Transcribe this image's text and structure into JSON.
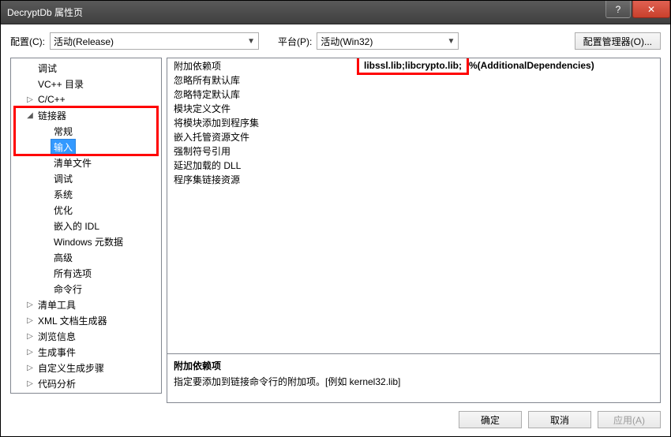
{
  "window": {
    "title": "DecryptDb 属性页"
  },
  "toolbar": {
    "config_label": "配置(C):",
    "config_value": "活动(Release)",
    "platform_label": "平台(P):",
    "platform_value": "活动(Win32)",
    "config_mgr": "配置管理器(O)..."
  },
  "tree": [
    {
      "label": "调试",
      "level": 1,
      "expand": ""
    },
    {
      "label": "VC++ 目录",
      "level": 1,
      "expand": ""
    },
    {
      "label": "C/C++",
      "level": 1,
      "expand": "▷"
    },
    {
      "label": "链接器",
      "level": 1,
      "expand": "◢"
    },
    {
      "label": "常规",
      "level": 2,
      "expand": ""
    },
    {
      "label": "输入",
      "level": 2,
      "expand": "",
      "selected": true
    },
    {
      "label": "清单文件",
      "level": 2,
      "expand": ""
    },
    {
      "label": "调试",
      "level": 2,
      "expand": ""
    },
    {
      "label": "系统",
      "level": 2,
      "expand": ""
    },
    {
      "label": "优化",
      "level": 2,
      "expand": ""
    },
    {
      "label": "嵌入的 IDL",
      "level": 2,
      "expand": ""
    },
    {
      "label": "Windows 元数据",
      "level": 2,
      "expand": ""
    },
    {
      "label": "高级",
      "level": 2,
      "expand": ""
    },
    {
      "label": "所有选项",
      "level": 2,
      "expand": ""
    },
    {
      "label": "命令行",
      "level": 2,
      "expand": ""
    },
    {
      "label": "清单工具",
      "level": 1,
      "expand": "▷"
    },
    {
      "label": "XML 文档生成器",
      "level": 1,
      "expand": "▷"
    },
    {
      "label": "浏览信息",
      "level": 1,
      "expand": "▷"
    },
    {
      "label": "生成事件",
      "level": 1,
      "expand": "▷"
    },
    {
      "label": "自定义生成步骤",
      "level": 1,
      "expand": "▷"
    },
    {
      "label": "代码分析",
      "level": 1,
      "expand": "▷"
    }
  ],
  "props": [
    {
      "k": "附加依赖项",
      "v": "libssl.lib;libcrypto.lib;%(AdditionalDependencies)",
      "hl": true
    },
    {
      "k": "忽略所有默认库",
      "v": ""
    },
    {
      "k": "忽略特定默认库",
      "v": ""
    },
    {
      "k": "模块定义文件",
      "v": ""
    },
    {
      "k": "将模块添加到程序集",
      "v": ""
    },
    {
      "k": "嵌入托管资源文件",
      "v": ""
    },
    {
      "k": "强制符号引用",
      "v": ""
    },
    {
      "k": "延迟加载的 DLL",
      "v": ""
    },
    {
      "k": "程序集链接资源",
      "v": ""
    }
  ],
  "desc": {
    "title": "附加依赖项",
    "body": "指定要添加到链接命令行的附加项。[例如 kernel32.lib]"
  },
  "footer": {
    "ok": "确定",
    "cancel": "取消",
    "apply": "应用(A)"
  }
}
